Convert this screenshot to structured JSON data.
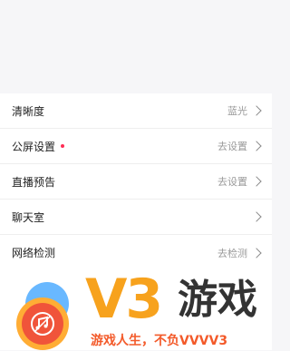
{
  "settings": {
    "items": [
      {
        "label": "清晰度",
        "value": "蓝光",
        "red_dot": false
      },
      {
        "label": "公屏设置",
        "value": "去设置",
        "red_dot": true
      },
      {
        "label": "直播预告",
        "value": "去设置",
        "red_dot": false
      },
      {
        "label": "聊天室",
        "value": "",
        "red_dot": false
      },
      {
        "label": "网络检测",
        "value": "去检测",
        "red_dot": false
      }
    ]
  },
  "watermark": {
    "brand": "V3",
    "brand_cn": "游戏",
    "slogan": "游戏人生，不负VVVV3",
    "colors": {
      "orange": "#f7a21d",
      "red": "#f0543a",
      "blue": "#69b8ff"
    }
  },
  "icons": {
    "chevron": "chevron-right-icon",
    "logo": "music-note-disc-icon"
  },
  "colors": {
    "accent_dot": "#ff2d55",
    "background": "#f6f6f8",
    "row_value": "#9a9a9a"
  }
}
